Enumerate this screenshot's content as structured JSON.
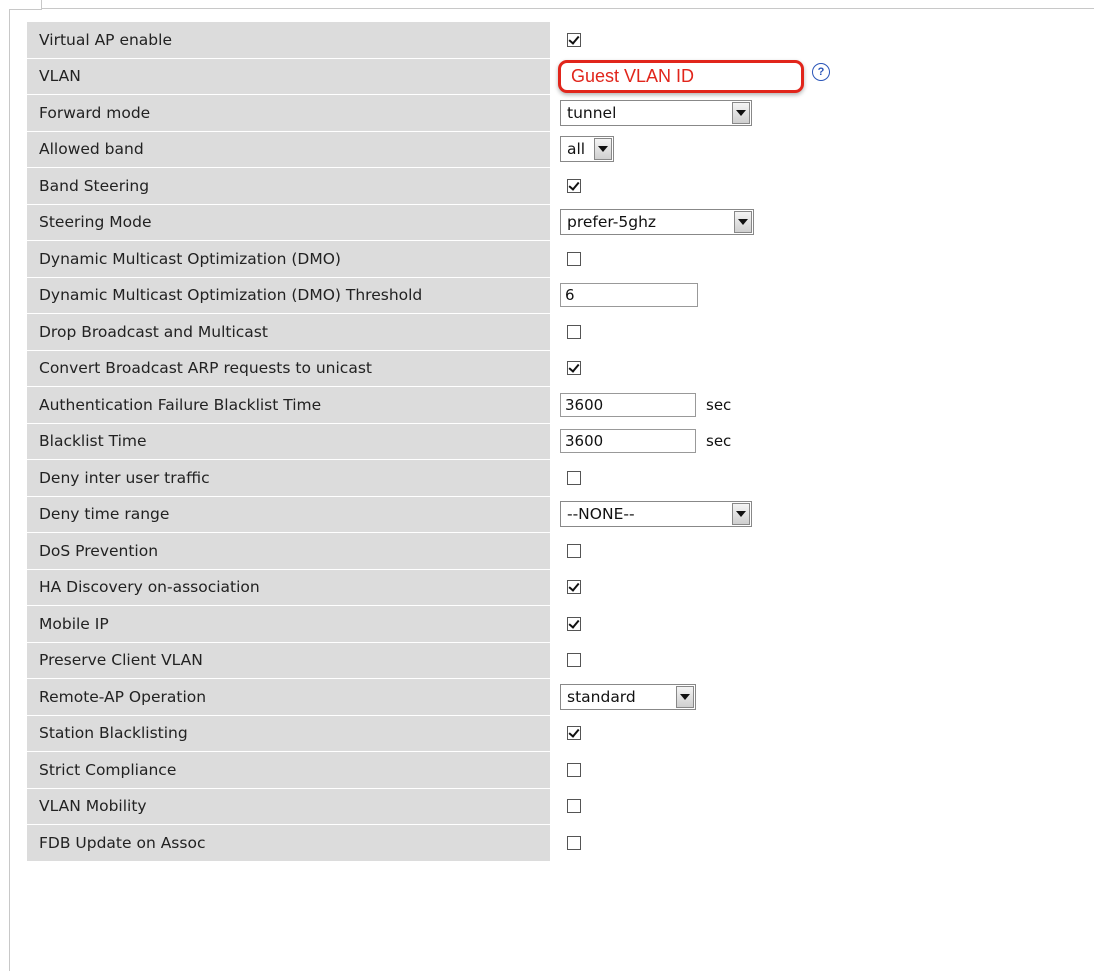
{
  "rows": [
    {
      "label": "Virtual AP enable",
      "type": "checkbox",
      "checked": true
    },
    {
      "label": "VLAN",
      "type": "vlan",
      "value": "Guest VLAN ID",
      "help": "?"
    },
    {
      "label": "Forward mode",
      "type": "select",
      "value": "tunnel",
      "width": 0
    },
    {
      "label": "Allowed band",
      "type": "select",
      "value": "all"
    },
    {
      "label": "Band Steering",
      "type": "checkbox",
      "checked": true
    },
    {
      "label": "Steering Mode",
      "type": "select",
      "value": "prefer-5ghz"
    },
    {
      "label": "Dynamic Multicast Optimization (DMO)",
      "type": "checkbox",
      "checked": false
    },
    {
      "label": "Dynamic Multicast Optimization (DMO) Threshold",
      "type": "text",
      "value": "6"
    },
    {
      "label": "Drop Broadcast and Multicast",
      "type": "checkbox",
      "checked": false
    },
    {
      "label": "Convert Broadcast ARP requests to unicast",
      "type": "checkbox",
      "checked": true
    },
    {
      "label": "Authentication Failure Blacklist Time",
      "type": "text",
      "value": "3600",
      "unit": "sec"
    },
    {
      "label": "Blacklist Time",
      "type": "text",
      "value": "3600",
      "unit": "sec"
    },
    {
      "label": "Deny inter user traffic",
      "type": "checkbox",
      "checked": false
    },
    {
      "label": "Deny time range",
      "type": "select",
      "value": "--NONE--"
    },
    {
      "label": "DoS Prevention",
      "type": "checkbox",
      "checked": false
    },
    {
      "label": "HA Discovery on-association",
      "type": "checkbox",
      "checked": true
    },
    {
      "label": "Mobile IP",
      "type": "checkbox",
      "checked": true
    },
    {
      "label": "Preserve Client VLAN",
      "type": "checkbox",
      "checked": false
    },
    {
      "label": "Remote-AP Operation",
      "type": "select",
      "value": "standard"
    },
    {
      "label": "Station Blacklisting",
      "type": "checkbox",
      "checked": true
    },
    {
      "label": "Strict Compliance",
      "type": "checkbox",
      "checked": false
    },
    {
      "label": "VLAN Mobility",
      "type": "checkbox",
      "checked": false
    },
    {
      "label": "FDB Update on Assoc",
      "type": "checkbox",
      "checked": false
    }
  ]
}
